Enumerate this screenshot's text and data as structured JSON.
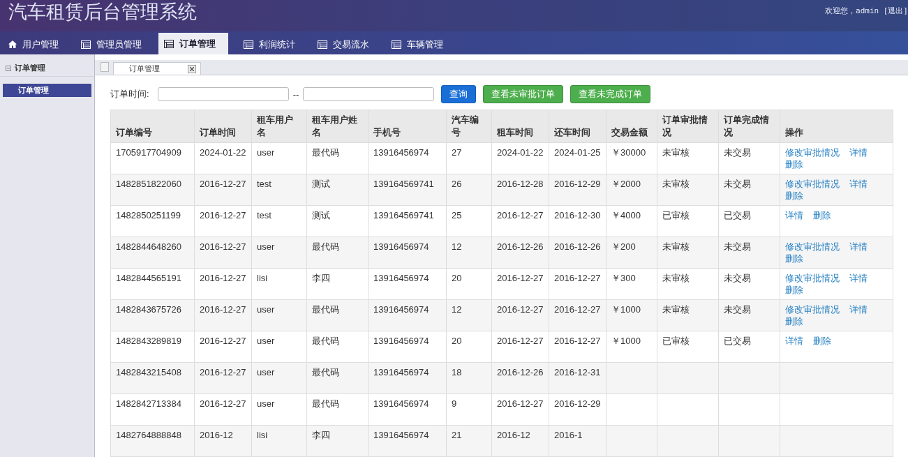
{
  "app_title": "汽车租赁后台管理系统",
  "user_bar": "欢迎您，admin [退出]",
  "nav_tabs": [
    {
      "label": "用户管理",
      "kind": "home",
      "selected": false
    },
    {
      "label": "管理员管理",
      "kind": "table",
      "selected": false
    },
    {
      "label": "订单管理",
      "kind": "table",
      "selected": true
    },
    {
      "label": "利润统计",
      "kind": "table",
      "selected": false
    },
    {
      "label": "交易流水",
      "kind": "table",
      "selected": false
    },
    {
      "label": "车辆管理",
      "kind": "table",
      "selected": false
    }
  ],
  "sidebar": {
    "title": "订单管理",
    "items": [
      {
        "label": "订单管理",
        "selected": true
      }
    ]
  },
  "page_tabs": [
    {
      "label": "订单管理",
      "selected": true
    }
  ],
  "filter": {
    "label": "订单时间:",
    "separator": "--",
    "buttons": [
      {
        "label": "查询",
        "kind": "primary"
      },
      {
        "label": "查看未审批订单",
        "kind": "success"
      },
      {
        "label": "查看未完成订单",
        "kind": "success"
      }
    ]
  },
  "table": {
    "columns": [
      "订单编号",
      "订单时间",
      "租车用户名",
      "租车用户姓名",
      "手机号",
      "汽车编号",
      "租车时间",
      "还车时间",
      "交易金额",
      "订单审批情况",
      "订单完成情况",
      "操作"
    ],
    "rows": [
      {
        "cells": [
          "1705917704909",
          "2024-01-22",
          "user",
          "最代码",
          "13916456974",
          "27",
          "2024-01-22",
          "2024-01-25",
          "￥30000",
          "未审核",
          "未交易"
        ],
        "actions": [
          "修改审批情况",
          "详情",
          "删除"
        ]
      },
      {
        "cells": [
          "1482851822060",
          "2016-12-27",
          "test",
          "测试",
          "139164569741",
          "26",
          "2016-12-28",
          "2016-12-29",
          "￥2000",
          "未审核",
          "未交易"
        ],
        "actions": [
          "修改审批情况",
          "详情",
          "删除"
        ]
      },
      {
        "cells": [
          "1482850251199",
          "2016-12-27",
          "test",
          "测试",
          "139164569741",
          "25",
          "2016-12-27",
          "2016-12-30",
          "￥4000",
          "已审核",
          "已交易"
        ],
        "actions": [
          "详情",
          "删除"
        ]
      },
      {
        "cells": [
          "1482844648260",
          "2016-12-27",
          "user",
          "最代码",
          "13916456974",
          "12",
          "2016-12-26",
          "2016-12-26",
          "￥200",
          "未审核",
          "未交易"
        ],
        "actions": [
          "修改审批情况",
          "详情",
          "删除"
        ]
      },
      {
        "cells": [
          "1482844565191",
          "2016-12-27",
          "lisi",
          "李四",
          "13916456974",
          "20",
          "2016-12-27",
          "2016-12-27",
          "￥300",
          "未审核",
          "未交易"
        ],
        "actions": [
          "修改审批情况",
          "详情",
          "删除"
        ]
      },
      {
        "cells": [
          "1482843675726",
          "2016-12-27",
          "user",
          "最代码",
          "13916456974",
          "12",
          "2016-12-27",
          "2016-12-27",
          "￥1000",
          "未审核",
          "未交易"
        ],
        "actions": [
          "修改审批情况",
          "详情",
          "删除"
        ]
      },
      {
        "cells": [
          "1482843289819",
          "2016-12-27",
          "user",
          "最代码",
          "13916456974",
          "20",
          "2016-12-27",
          "2016-12-27",
          "￥1000",
          "已审核",
          "已交易"
        ],
        "actions": [
          "详情",
          "删除"
        ]
      },
      {
        "cells": [
          "1482843215408",
          "2016-12-27",
          "user",
          "最代码",
          "13916456974",
          "18",
          "2016-12-26",
          "2016-12-31"
        ],
        "actions": []
      },
      {
        "cells": [
          "1482842713384",
          "2016-12-27",
          "user",
          "最代码",
          "13916456974",
          "9",
          "2016-12-27",
          "2016-12-29"
        ],
        "actions": []
      },
      {
        "cells": [
          "1482764888848",
          "2016-12",
          "lisi",
          "李四",
          "13916456974",
          "21",
          "2016-12",
          "2016-1"
        ],
        "actions": []
      }
    ]
  }
}
